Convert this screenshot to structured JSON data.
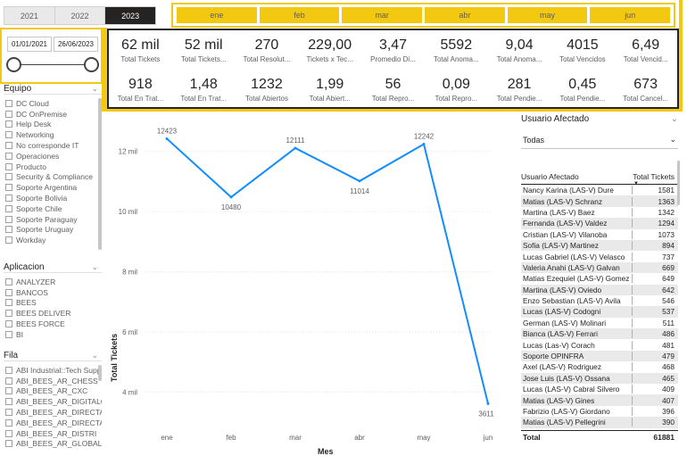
{
  "years": [
    "2021",
    "2022",
    "2023"
  ],
  "selected_year": "2023",
  "months": [
    "ene",
    "feb",
    "mar",
    "abr",
    "may",
    "jun"
  ],
  "date_range": {
    "start": "01/01/2021",
    "end": "26/06/2023"
  },
  "kpis_row1": [
    {
      "value": "62 mil",
      "label": "Total Tickets"
    },
    {
      "value": "52 mil",
      "label": "Total Tickets..."
    },
    {
      "value": "270",
      "label": "Total Resolut..."
    },
    {
      "value": "229,00",
      "label": "Tickets x Tec..."
    },
    {
      "value": "3,47",
      "label": "Promedio Di..."
    },
    {
      "value": "5592",
      "label": "Total Anoma..."
    },
    {
      "value": "9,04",
      "label": "Total Anoma..."
    },
    {
      "value": "4015",
      "label": "Total Vencidos"
    },
    {
      "value": "6,49",
      "label": "Total Vencid..."
    }
  ],
  "kpis_row2": [
    {
      "value": "918",
      "label": "Total En Trat..."
    },
    {
      "value": "1,48",
      "label": "Total En Trat..."
    },
    {
      "value": "1232",
      "label": "Total Abiertos"
    },
    {
      "value": "1,99",
      "label": "Total Abiert..."
    },
    {
      "value": "56",
      "label": "Total Repro..."
    },
    {
      "value": "0,09",
      "label": "Total Repro..."
    },
    {
      "value": "281",
      "label": "Total Pendie..."
    },
    {
      "value": "0,45",
      "label": "Total Pendie..."
    },
    {
      "value": "673",
      "label": "Total Cancel..."
    }
  ],
  "equipo": {
    "title": "Equipo",
    "items": [
      "DC Cloud",
      "DC OnPremise",
      "Help Desk",
      "Networking",
      "No corresponde IT",
      "Operaciones",
      "Producto",
      "Security & Compliance",
      "Soporte Argentina",
      "Soporte Bolivia",
      "Soporte Chile",
      "Soporte Paraguay",
      "Soporte Uruguay",
      "Workday"
    ]
  },
  "aplicacion": {
    "title": "Aplicacion",
    "items": [
      "ANALYZER",
      "BANCOS",
      "BEES",
      "BEES DELIVER",
      "BEES FORCE",
      "BI"
    ]
  },
  "fila": {
    "title": "Fila",
    "items": [
      "ABI Industrial::Tech Supp...",
      "ABI_BEES_AR_CHESS",
      "ABI_BEES_AR_CXC",
      "ABI_BEES_AR_DIGITALC...",
      "ABI_BEES_AR_DIRECTAS",
      "ABI_BEES_AR_DIRECTAS_...",
      "ABI_BEES_AR_DISTRI",
      "ABI_BEES_AR_GLOBAL_D..."
    ]
  },
  "chart_data": {
    "type": "line",
    "categories": [
      "ene",
      "feb",
      "mar",
      "abr",
      "may",
      "jun"
    ],
    "values": [
      12423,
      10480,
      12111,
      11014,
      12242,
      3611
    ],
    "data_labels": [
      "12423",
      "10480",
      "12111",
      "11014",
      "12242",
      "3611"
    ],
    "xlabel": "Mes",
    "ylabel": "Total Tickets",
    "yticks": [
      4000,
      6000,
      8000,
      10000,
      12000
    ],
    "ytick_labels": [
      "4 mil",
      "6 mil",
      "8 mil",
      "10 mil",
      "12 mil"
    ],
    "ylim": [
      3000,
      13000
    ],
    "color": "#118dff",
    "grid": true
  },
  "usuario": {
    "title": "Usuario Afectado",
    "dropdown_value": "Todas",
    "col1": "Usuario Afectado",
    "col2": "Total Tickets",
    "rows": [
      [
        "Nancy Karina (LAS-V) Dure",
        "1581"
      ],
      [
        "Matias (LAS-V) Schranz",
        "1363"
      ],
      [
        "Martina (LAS-V) Baez",
        "1342"
      ],
      [
        "Fernanda (LAS-V) Valdez",
        "1294"
      ],
      [
        "Cristian (LAS-V) Vilanoba",
        "1073"
      ],
      [
        "Sofia (LAS-V) Martinez",
        "894"
      ],
      [
        "Lucas Gabriel (LAS-V) Velasco",
        "737"
      ],
      [
        "Valeria Anahi (LAS-V) Galvan",
        "669"
      ],
      [
        "Matias Ezequiel (LAS-V) Gomez",
        "649"
      ],
      [
        "Martina (LAS-V) Oviedo",
        "642"
      ],
      [
        "Enzo Sebastian (LAS-V) Avila",
        "546"
      ],
      [
        "Lucas (LAS-V) Codogni",
        "537"
      ],
      [
        "German (LAS-V) Molinari",
        "511"
      ],
      [
        "Bianca (LAS-V) Ferrari",
        "486"
      ],
      [
        "Lucas (Las-V) Corach",
        "481"
      ],
      [
        "Soporte OPINFRA",
        "479"
      ],
      [
        "Axel (LAS-V) Rodriguez",
        "468"
      ],
      [
        "Jose Luis (LAS-V) Ossana",
        "465"
      ],
      [
        "Lucas (LAS-V) Cabral Silvero",
        "409"
      ],
      [
        "Matias (LAS-V) Gines",
        "407"
      ],
      [
        "Fabrizio (LAS-V) Giordano",
        "396"
      ],
      [
        "Matias (LAS-V) Pellegrini",
        "390"
      ]
    ],
    "total_label": "Total",
    "total_value": "61881"
  }
}
